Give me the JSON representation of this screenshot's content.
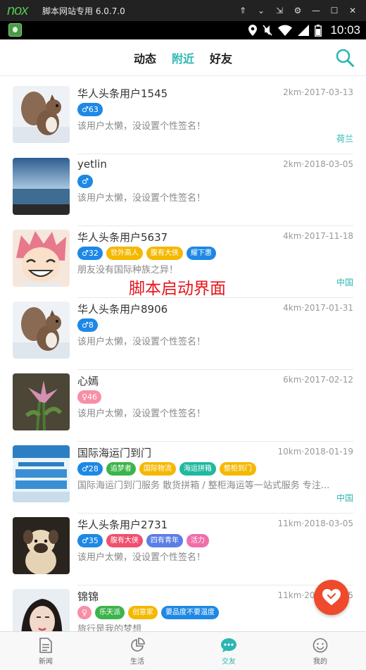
{
  "emulator": {
    "logo": "nox",
    "title": "脚本网站专用 6.0.7.0",
    "buttons": [
      "⇑",
      "⌄",
      "⇲",
      "⚙",
      "—",
      "☐",
      "✕"
    ]
  },
  "status_bar": {
    "time": "10:03",
    "icons": [
      "location-icon",
      "mute-icon",
      "wifi-icon",
      "signal-icon",
      "battery-icon"
    ]
  },
  "header": {
    "tabs": [
      {
        "label": "动态",
        "active": false
      },
      {
        "label": "附近",
        "active": true
      },
      {
        "label": "好友",
        "active": false
      }
    ],
    "accent": "#2bb7b3"
  },
  "feed": [
    {
      "name": "华人头条用户1545",
      "meta": "2km·2017-03-13",
      "gender": "male",
      "gender_text": "♂63",
      "tags": [],
      "signature": "该用户太懒，没设置个性签名！",
      "location": "荷兰",
      "avatar": "squirrel"
    },
    {
      "name": "yetlin",
      "meta": "2km·2018-03-05",
      "gender": "male",
      "gender_text": "♂",
      "tags": [],
      "signature": "该用户太懒，没设置个性签名！",
      "location": "",
      "avatar": "sea"
    },
    {
      "name": "华人头条用户5637",
      "meta": "4km·2017-11-18",
      "gender": "male",
      "gender_text": "♂32",
      "tags": [
        {
          "text": "世外高人",
          "color": "#f5b800"
        },
        {
          "text": "腹有大侠",
          "color": "#f5b800"
        },
        {
          "text": "耀下惠",
          "color": "#1e88e5"
        }
      ],
      "signature": "朋友没有国际种族之异！",
      "location": "中国",
      "avatar": "anime"
    },
    {
      "name": "华人头条用户8906",
      "meta": "4km·2017-01-31",
      "gender": "male",
      "gender_text": "♂8",
      "tags": [],
      "signature": "该用户太懒，没设置个性签名！",
      "location": "",
      "avatar": "squirrel"
    },
    {
      "name": "心嫣",
      "meta": "6km·2017-02-12",
      "gender": "female",
      "gender_text": "♀46",
      "tags": [],
      "signature": "该用户太懒，没设置个性签名！",
      "location": "",
      "avatar": "flower"
    },
    {
      "name": "国际海运门到门",
      "meta": "10km·2018-01-19",
      "gender": "male",
      "gender_text": "♂28",
      "tags": [
        {
          "text": "追梦者",
          "color": "#3cb44b"
        },
        {
          "text": "国际物流",
          "color": "#f5b800"
        },
        {
          "text": "海运拼箱",
          "color": "#20b8a0"
        },
        {
          "text": "整柜到门",
          "color": "#f5b800"
        }
      ],
      "signature": "国际海运门到门服务 散货拼箱 / 整柜海运等一站式服务 专注...",
      "location": "中国",
      "avatar": "shipping"
    },
    {
      "name": "华人头条用户2731",
      "meta": "11km·2018-03-05",
      "gender": "male",
      "gender_text": "♂35",
      "tags": [
        {
          "text": "腹有大侠",
          "color": "#f0506e"
        },
        {
          "text": "四有青年",
          "color": "#5b7ee5"
        },
        {
          "text": "活力",
          "color": "#f06eaa"
        }
      ],
      "signature": "该用户太懒，没设置个性签名！",
      "location": "",
      "avatar": "puppy"
    },
    {
      "name": "锦锦",
      "meta": "11km·2018-02-15",
      "gender": "female",
      "gender_text": "♀",
      "tags": [
        {
          "text": "乐天派",
          "color": "#3cb44b"
        },
        {
          "text": "创意家",
          "color": "#f5b800"
        },
        {
          "text": "要品度不要温度",
          "color": "#1e88e5"
        }
      ],
      "signature": "旅行是我的梦想",
      "location": "",
      "avatar": "woman"
    }
  ],
  "overlay_label": "脚本启动界面",
  "bottom_nav": [
    {
      "label": "新闻",
      "icon": "news-icon",
      "active": false
    },
    {
      "label": "生活",
      "icon": "life-icon",
      "active": false
    },
    {
      "label": "交友",
      "icon": "chat-icon",
      "active": true
    },
    {
      "label": "我的",
      "icon": "profile-icon",
      "active": false
    }
  ],
  "colors": {
    "male": "#1e88e5",
    "female": "#f78fa7",
    "fab": "#ee4a2b"
  }
}
